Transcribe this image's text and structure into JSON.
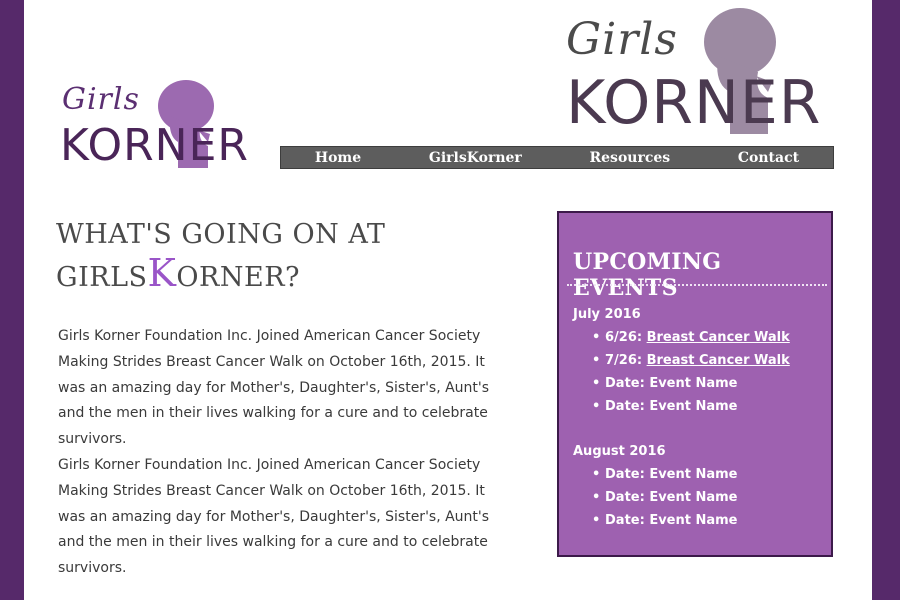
{
  "logo": {
    "script": "Girls",
    "word": "KORNER"
  },
  "nav": [
    "Home",
    "GirlsKorner",
    "Resources",
    "Contact"
  ],
  "main": {
    "title_part1": "WHAT'S GOING ON AT GIRLS",
    "title_k": "K",
    "title_part2": "ORNER?",
    "paragraphs": [
      "Girls Korner Foundation Inc. Joined American Cancer Society Making Strides Breast Cancer Walk on October 16th, 2015. It was an amazing day for Mother's, Daughter's, Sister's, Aunt's and the men in their lives walking for a cure and to celebrate survivors.",
      "Girls Korner Foundation Inc. Joined American Cancer Society Making Strides Breast Cancer Walk on October 16th, 2015. It was an amazing day for Mother's, Daughter's, Sister's, Aunt's and the men in their lives walking for a cure and to celebrate survivors."
    ]
  },
  "events": {
    "title": "UPCOMING EVENTS",
    "groups": [
      {
        "month": "July 2016",
        "items": [
          {
            "prefix": "6/26: ",
            "link": "Breast Cancer Walk"
          },
          {
            "prefix": "7/26: ",
            "link": "Breast Cancer Walk"
          },
          {
            "prefix": "Date: Event Name",
            "link": ""
          },
          {
            "prefix": "Date: Event Name",
            "link": ""
          }
        ]
      },
      {
        "month": "August 2016",
        "items": [
          {
            "prefix": "Date: Event Name",
            "link": ""
          },
          {
            "prefix": "Date: Event Name",
            "link": ""
          },
          {
            "prefix": "Date: Event Name",
            "link": ""
          }
        ]
      }
    ]
  },
  "colors": {
    "frame": "#56296a",
    "accent_purple": "#9e61b0",
    "k_highlight": "#9a55c8",
    "nav_bg": "#5d5d5d",
    "logo_dark": "#4a2558",
    "logo_gray": "#5a4a5e"
  },
  "icons": [
    "silhouette-logo-icon",
    "bullet-icon"
  ]
}
